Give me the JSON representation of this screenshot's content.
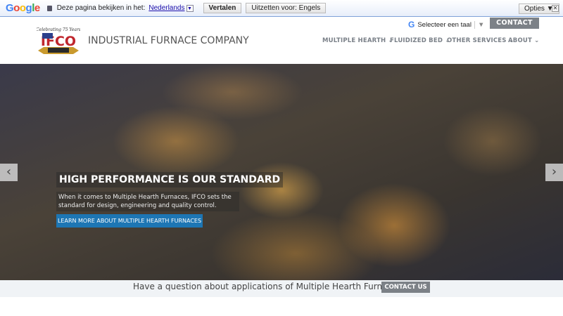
{
  "translate_bar": {
    "logo": "Google",
    "prompt": "Deze pagina bekijken in het:",
    "language": "Nederlands",
    "translate": "Vertalen",
    "turn_off": "Uitzetten voor: Engels",
    "options": "Opties ▼",
    "close": "✕"
  },
  "header": {
    "logo_text": "Celebrating 75 Years IFCO",
    "company": "INDUSTRIAL FURNACE COMPANY",
    "select_language": "Selecteer een taal",
    "contact": "CONTACT US"
  },
  "nav": [
    {
      "label": "MULTIPLE HEARTH"
    },
    {
      "label": "FLUIDIZED BED"
    },
    {
      "label": "OTHER SERVICES"
    },
    {
      "label": "ABOUT"
    }
  ],
  "hero": {
    "title": "HIGH PERFORMANCE IS OUR STANDARD",
    "subtitle": "When it comes to Multiple Hearth Furnaces, IFCO sets the standard for design, engineering and quality control.",
    "cta": "LEARN MORE ABOUT MULTIPLE HEARTH FURNACES",
    "prev": "‹",
    "next": "›"
  },
  "question": {
    "text": "Have a question about applications of Multiple Hearth Furnaces?",
    "button": "CONTACT US"
  }
}
